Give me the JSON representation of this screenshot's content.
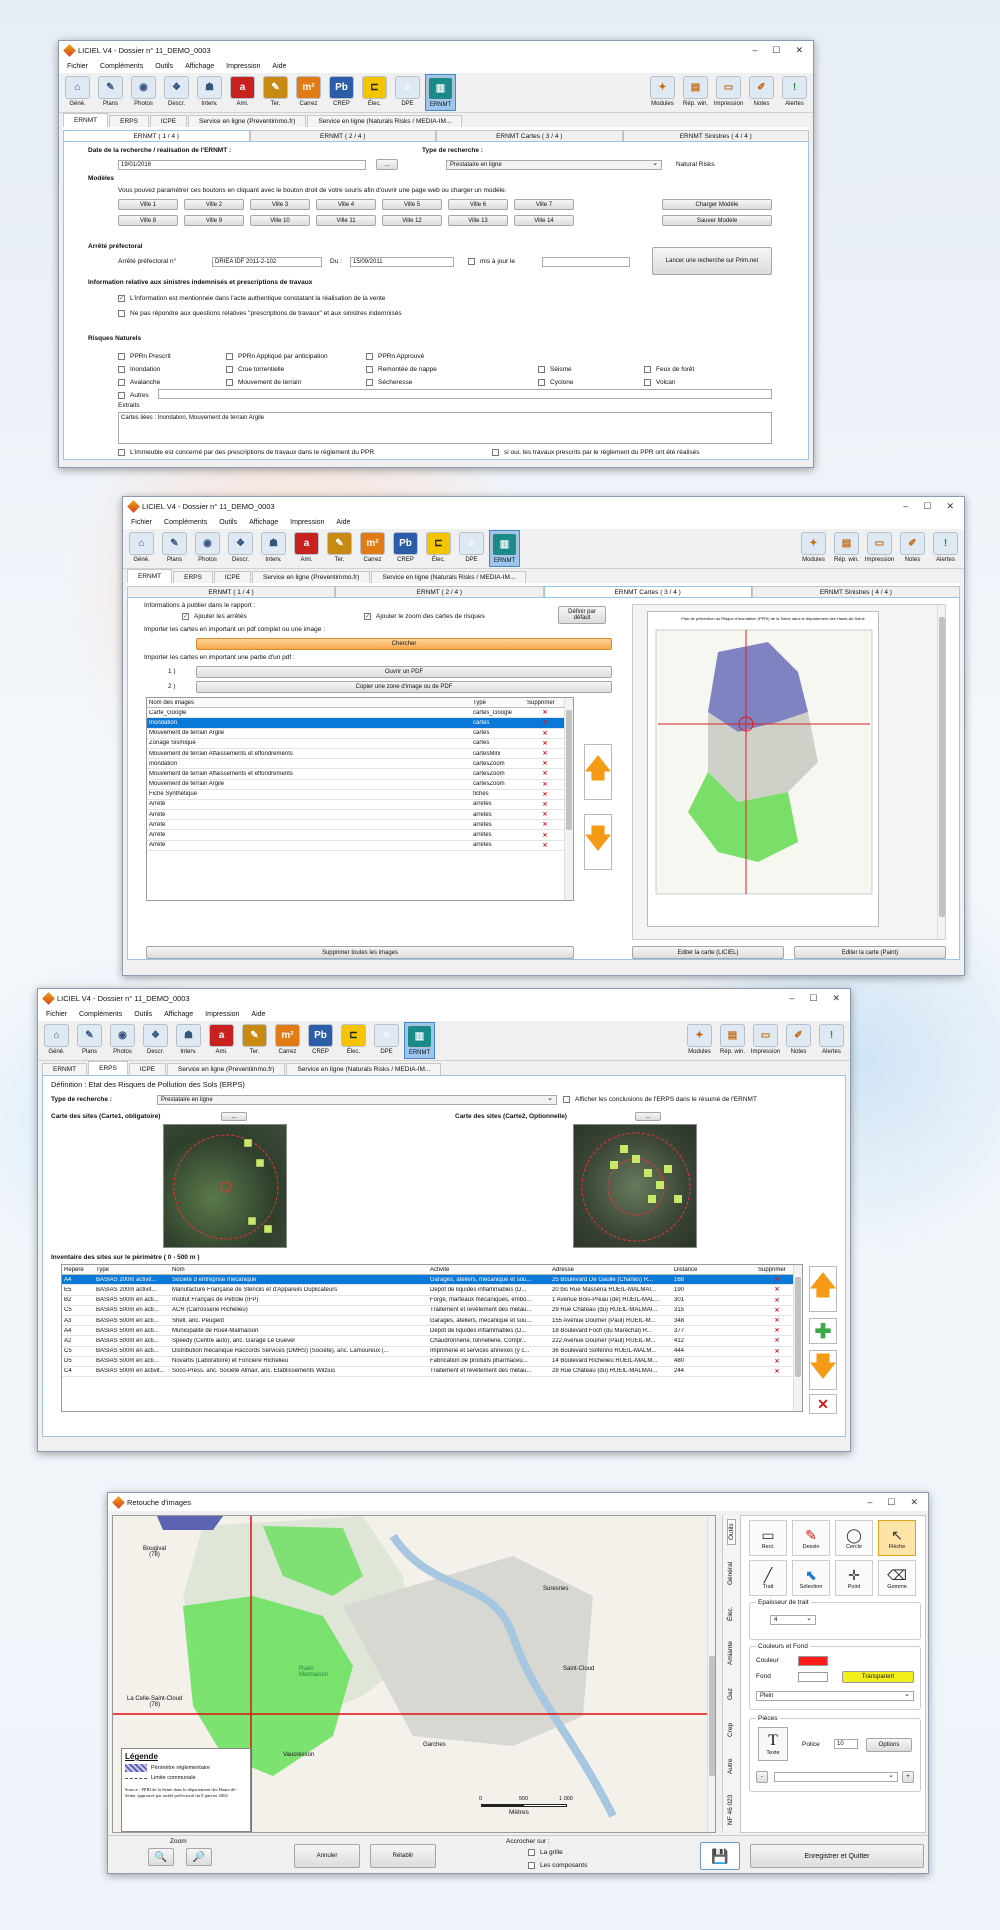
{
  "app": {
    "window_title": "LICIEL V4 - Dossier n° 11_DEMO_0003"
  },
  "menu": [
    "Fichier",
    "Compléments",
    "Outils",
    "Affichage",
    "Impression",
    "Aide"
  ],
  "toolbar": {
    "tools": [
      {
        "label": "Géné.",
        "icon": "house-icon",
        "glyph": "⌂"
      },
      {
        "label": "Plans",
        "icon": "plans-icon",
        "glyph": "✎"
      },
      {
        "label": "Photos",
        "icon": "camera-icon",
        "glyph": "◉"
      },
      {
        "label": "Descr.",
        "icon": "description-icon",
        "glyph": "❖"
      },
      {
        "label": "Interv.",
        "icon": "intervention-icon",
        "glyph": "☗"
      },
      {
        "label": "Ami.",
        "icon": "amiante-icon",
        "glyph": "a"
      },
      {
        "label": "Ter.",
        "icon": "termites-icon",
        "glyph": "✎"
      },
      {
        "label": "Carrez",
        "icon": "carrez-icon",
        "glyph": "m²"
      },
      {
        "label": "CREP",
        "icon": "crep-icon",
        "glyph": "Pb"
      },
      {
        "label": "Élec.",
        "icon": "electricity-icon",
        "glyph": "⊏"
      },
      {
        "label": "DPE",
        "icon": "dpe-icon",
        "glyph": "≡"
      },
      {
        "label": "ERNMT",
        "icon": "ernmt-icon",
        "glyph": "▥"
      }
    ],
    "right_tools": [
      {
        "label": "Modules",
        "icon": "modules-icon",
        "glyph": "✦"
      },
      {
        "label": "Rép. win.",
        "icon": "folder-icon",
        "glyph": "▤"
      },
      {
        "label": "Impression",
        "icon": "printer-icon",
        "glyph": "▭"
      },
      {
        "label": "Notes",
        "icon": "notes-icon",
        "glyph": "✐"
      },
      {
        "label": "Alertes",
        "icon": "alert-icon",
        "glyph": "!"
      }
    ]
  },
  "main_tabs": [
    "ERNMT",
    "ERPS",
    "ICPE",
    "Service en ligne (Preventimmo.fr)",
    "Service en ligne (Naturals Risks / MEDIA-IM..."
  ],
  "sub_tabs": [
    "ERNMT ( 1 / 4 )",
    "ERNMT ( 2 / 4 )",
    "ERNMT Cartes ( 3 / 4 )",
    "ERNMT Sinistres ( 4 / 4 )"
  ],
  "w1": {
    "date_label": "Date de la recherche / réalisation de l'ERNMT :",
    "date_value": "19/01/2016",
    "date_btn": "...",
    "type_label": "Type de recherche :",
    "type_value": "Prestataire en ligne",
    "natural_risks": "Natural Risks",
    "modeles_title": "Modèles",
    "modeles_desc": "Vous pouvez paramétrer ces boutons en cliquant avec le bouton droit de votre souris afin d'ouvrir une page web ou charger un modèle.",
    "villes": [
      "Ville 1",
      "Ville 2",
      "Ville 3",
      "Ville 4",
      "Ville 5",
      "Ville 6",
      "Ville 7",
      "Ville 8",
      "Ville 9",
      "Ville 10",
      "Ville 11",
      "Ville 12",
      "Ville 13",
      "Ville 14"
    ],
    "charger": "Charger Modèle",
    "sauver": "Sauver Modèle",
    "arrete_title": "Arrêté préfectoral",
    "arrete_label": "Arrêté préfectoral n°",
    "arrete_value": "DRIEA IDF 2011-2-102",
    "du_label": "Du :",
    "du_value": "15/09/2011",
    "mis_a_jour": "mis à jour le",
    "lancer": "Lancer une recherche sur Prim.net",
    "info_title": "Information relative aux sinistres indemnisés et prescriptions de travaux",
    "info_opt1": "L'information est mentionnée dans l'acte authentique constatant la réalisation de la vente",
    "info_opt2": "Ne pas répondre aux questions relatives \"prescriptions de travaux\" et aux sinistres indemnisés",
    "risques_title": "Risques Naturels",
    "risques": [
      "PPRn Prescrit",
      "PPRn Appliqué par anticipation",
      "PPRn Approuvé",
      "Inondation",
      "Crue torrentielle",
      "Remontée de nappe",
      "Séisme",
      "Feux de forêt",
      "Avalanche",
      "Mouvement de terrain",
      "Sécheresse",
      "Cyclone",
      "Volcan",
      "Autres"
    ],
    "extraits_label": "Extraits",
    "extraits_value": "Cartes liées : Inondation, Mouvement de terrain Argile",
    "footer1": "L'immeuble est concerné par des prescriptions de travaux dans le règlement du PPR",
    "footer2": "si oui, les travaux prescrits par le règlement du PPR ont été réalisés"
  },
  "w2": {
    "info_publier": "Informations à publier dans le rapport :",
    "ajouter_arretes": "Ajouter les arrêtés",
    "ajouter_zoom": "Ajouter le zoom des cartes de risques",
    "definir": "Définir par défaut",
    "importer_pdf": "Importer les cartes en important un pdf complet ou une image :",
    "chercher": "Chercher",
    "importer_partie": "Importer les cartes en important une partie d'un pdf :",
    "step1": "1 )",
    "step2": "2 )",
    "ouvrir_pdf": "Ouvrir un PDF",
    "copier_zone": "Copier une zone d'image ou de PDF",
    "cols": [
      "Nom des images",
      "Type",
      "Supprimer"
    ],
    "rows": [
      [
        "Carte_Google",
        "cartes_Google"
      ],
      [
        "Inondation",
        "cartes"
      ],
      [
        "Mouvement de terrain Argile",
        "cartes"
      ],
      [
        "Zonage Sismique",
        "cartes"
      ],
      [
        "Mouvement de terrain Affaissements et effondrements",
        "cartesMini"
      ],
      [
        "Inondation",
        "cartesZoom"
      ],
      [
        "Mouvement de terrain Affaissements et effondrements",
        "cartesZoom"
      ],
      [
        "Mouvement de terrain Argile",
        "cartesZoom"
      ],
      [
        "Fiche Synthétique",
        "fiches"
      ],
      [
        "Arrêté",
        "arretes"
      ],
      [
        "Arrêté",
        "arretes"
      ],
      [
        "Arrêté",
        "arretes"
      ],
      [
        "Arrêté",
        "arretes"
      ],
      [
        "Arrêté",
        "arretes"
      ]
    ],
    "supprimer_toutes": "Supprimer toutes les images",
    "editer_luciel": "Editer la carte (LICIEL)",
    "editer_paint": "Editer la carte (Paint)",
    "map_title": "Plan de prévention du Risque d'Inondation (PPRI) de la Seine dans le département des Hauts-de-Seine"
  },
  "w3": {
    "definition": "Définition : Etat des Risques de Pollution des Sols (ERPS)",
    "type_label": "Type de recherche :",
    "type_value": "Prestataire en ligne",
    "afficher": "Afficher les conclusions de l'ERPS dans le résumé de l'ERNMT",
    "carte1": "Carte des sites (Carte1, obligatoire)",
    "carte2": "Carte des sites (Carte2, Optionnelle)",
    "dots": "...",
    "inventaire": "Inventaire des sites sur le périmètre ( 0 - 500 m )",
    "cols": [
      "Repère",
      "Type",
      "Nom",
      "Activité",
      "Adresse",
      "Distance",
      "Supprimer"
    ],
    "rows": [
      [
        "A4",
        "BASIAS 200m activit...",
        "Société d entreprise mécanique",
        "Garages, ateliers, mécanique et sou...",
        "25 Boulevard De Gaulle (Charles) R...",
        "168"
      ],
      [
        "E5",
        "BASIAS 200m activit...",
        "Manufacture Française de Stencils et d'Appareils Duplicateurs",
        "Dépôt de liquides inflammables (D...",
        "20 bis Rue Masséna RUEIL-MALMAI...",
        "190"
      ],
      [
        "B2",
        "BASIAS 500m en acti...",
        "Institut Français de Pétrole (IFP)",
        "Forge, marteaux mécaniques, embo...",
        "1 Avenue Bois-Préau (de) RUEIL-MAL...",
        "301"
      ],
      [
        "C5",
        "BASIAS 500m en acti...",
        "ACR (Carrosserie Richelieu)",
        "Traitement et revêtement des métau...",
        "29 Rue Château (du) RUEIL-MALMAI...",
        "315"
      ],
      [
        "A3",
        "BASIAS 500m en acti...",
        "Shell, anc. Peugeot",
        "Garages, ateliers, mécanique et sou...",
        "155 Avenue Doumer (Paul) RUEIL-M...",
        "348"
      ],
      [
        "A4",
        "BASIAS 500m en acti...",
        "Municipalité de Rueil-Malmaison",
        "Dépôt de liquides inflammables (D...",
        "18 Boulevard Foch (du Maréchal) R...",
        "377"
      ],
      [
        "A2",
        "BASIAS 500m en acti...",
        "Speedy (Centre auto), anc. Garage Le Guevel",
        "Chaudronnerie, tonnellerie, Compr...",
        "222 Avenue Doumer (Paul) RUEIL-M...",
        "412"
      ],
      [
        "C5",
        "BASIAS 500m en acti...",
        "Distribution mécanique Raccords Services (DMRS) (Société), anc. Lamoureux (...",
        "Imprimerie et services annexes (y c...",
        "36 Boulevard Solférino RUEIL-MALM...",
        "444"
      ],
      [
        "D5",
        "BASIAS 500m en acti...",
        "Novartis (Laboratoire) et Foncière Richelieu",
        "Fabrication de produits pharmaceu...",
        "14 Boulevard Richelieu RUEIL-MALM...",
        "480"
      ],
      [
        "C4",
        "BASIAS 500m en activit...",
        "Soco-Press, anc. Société Almair, anc. Etablissements Wilzius",
        "Traitement et revêtement des métau...",
        "28 Rue Château (du) RUEIL-MALMAI...",
        "244"
      ]
    ]
  },
  "w4": {
    "title": "Retouche d'images",
    "vtabs": [
      "Outils",
      "Général",
      "Élec.",
      "Amiante",
      "Gaz",
      "Crep",
      "Autre",
      "NF 46 023"
    ],
    "tools": [
      {
        "label": "Rect.",
        "icon": "rectangle-icon",
        "glyph": "▭"
      },
      {
        "label": "Dessin",
        "icon": "pen-icon",
        "glyph": "✎"
      },
      {
        "label": "Cercle",
        "icon": "circle-icon",
        "glyph": "◯"
      },
      {
        "label": "Flèche",
        "icon": "cursor-arrow-icon",
        "glyph": "↖"
      },
      {
        "label": "Trait",
        "icon": "line-icon",
        "glyph": "╱"
      },
      {
        "label": "Sélection",
        "icon": "selection-icon",
        "glyph": "⬉"
      },
      {
        "label": "Point",
        "icon": "point-icon",
        "glyph": "✛"
      },
      {
        "label": "Gomme",
        "icon": "eraser-icon",
        "glyph": "⌫"
      }
    ],
    "epaisseur_label": "Epaisseur de trait",
    "epaisseur_value": "4",
    "couleurs_title": "Couleurs et Fond",
    "couleur_label": "Couleur",
    "fond_label": "Fond",
    "transparent": "Transparent",
    "plein": "Plein",
    "couleur_hex": "#ff1a1a",
    "pieces_title": "Pièces",
    "texte_label": "Texte",
    "police_label": "Police",
    "police_value": "10",
    "options": "Options",
    "plus": "+",
    "minus": "-",
    "zoom_label": "Zoom",
    "annuler": "Annuler",
    "retablir": "Rétablir",
    "accrocher": "Accrocher sur :",
    "grille": "La grille",
    "composants": "Les composants",
    "enregistrer": "Enregistrer et Quitter",
    "map_labels": {
      "bougival": "Bougival\n(78)",
      "suresnes": "Suresnes",
      "celle": "La Celle-Saint-Cloud\n(78)",
      "saintcloud": "Saint-Cloud",
      "vaucresson": "Vaucresson",
      "garches": "Garches",
      "rueil": "Rueil-\nMalmaison"
    },
    "legend_title": "Légende",
    "legend_items": [
      "Périmètre réglementaire",
      "Limite communale"
    ],
    "legend_source": "Source : PPRI de la Seine dans le département des Hauts-de-Seine, approuvé par arrêté préfectoral du 9 janvier 2004",
    "scale": [
      "0",
      "500",
      "1 000"
    ],
    "scale_unit": "Mètres"
  }
}
